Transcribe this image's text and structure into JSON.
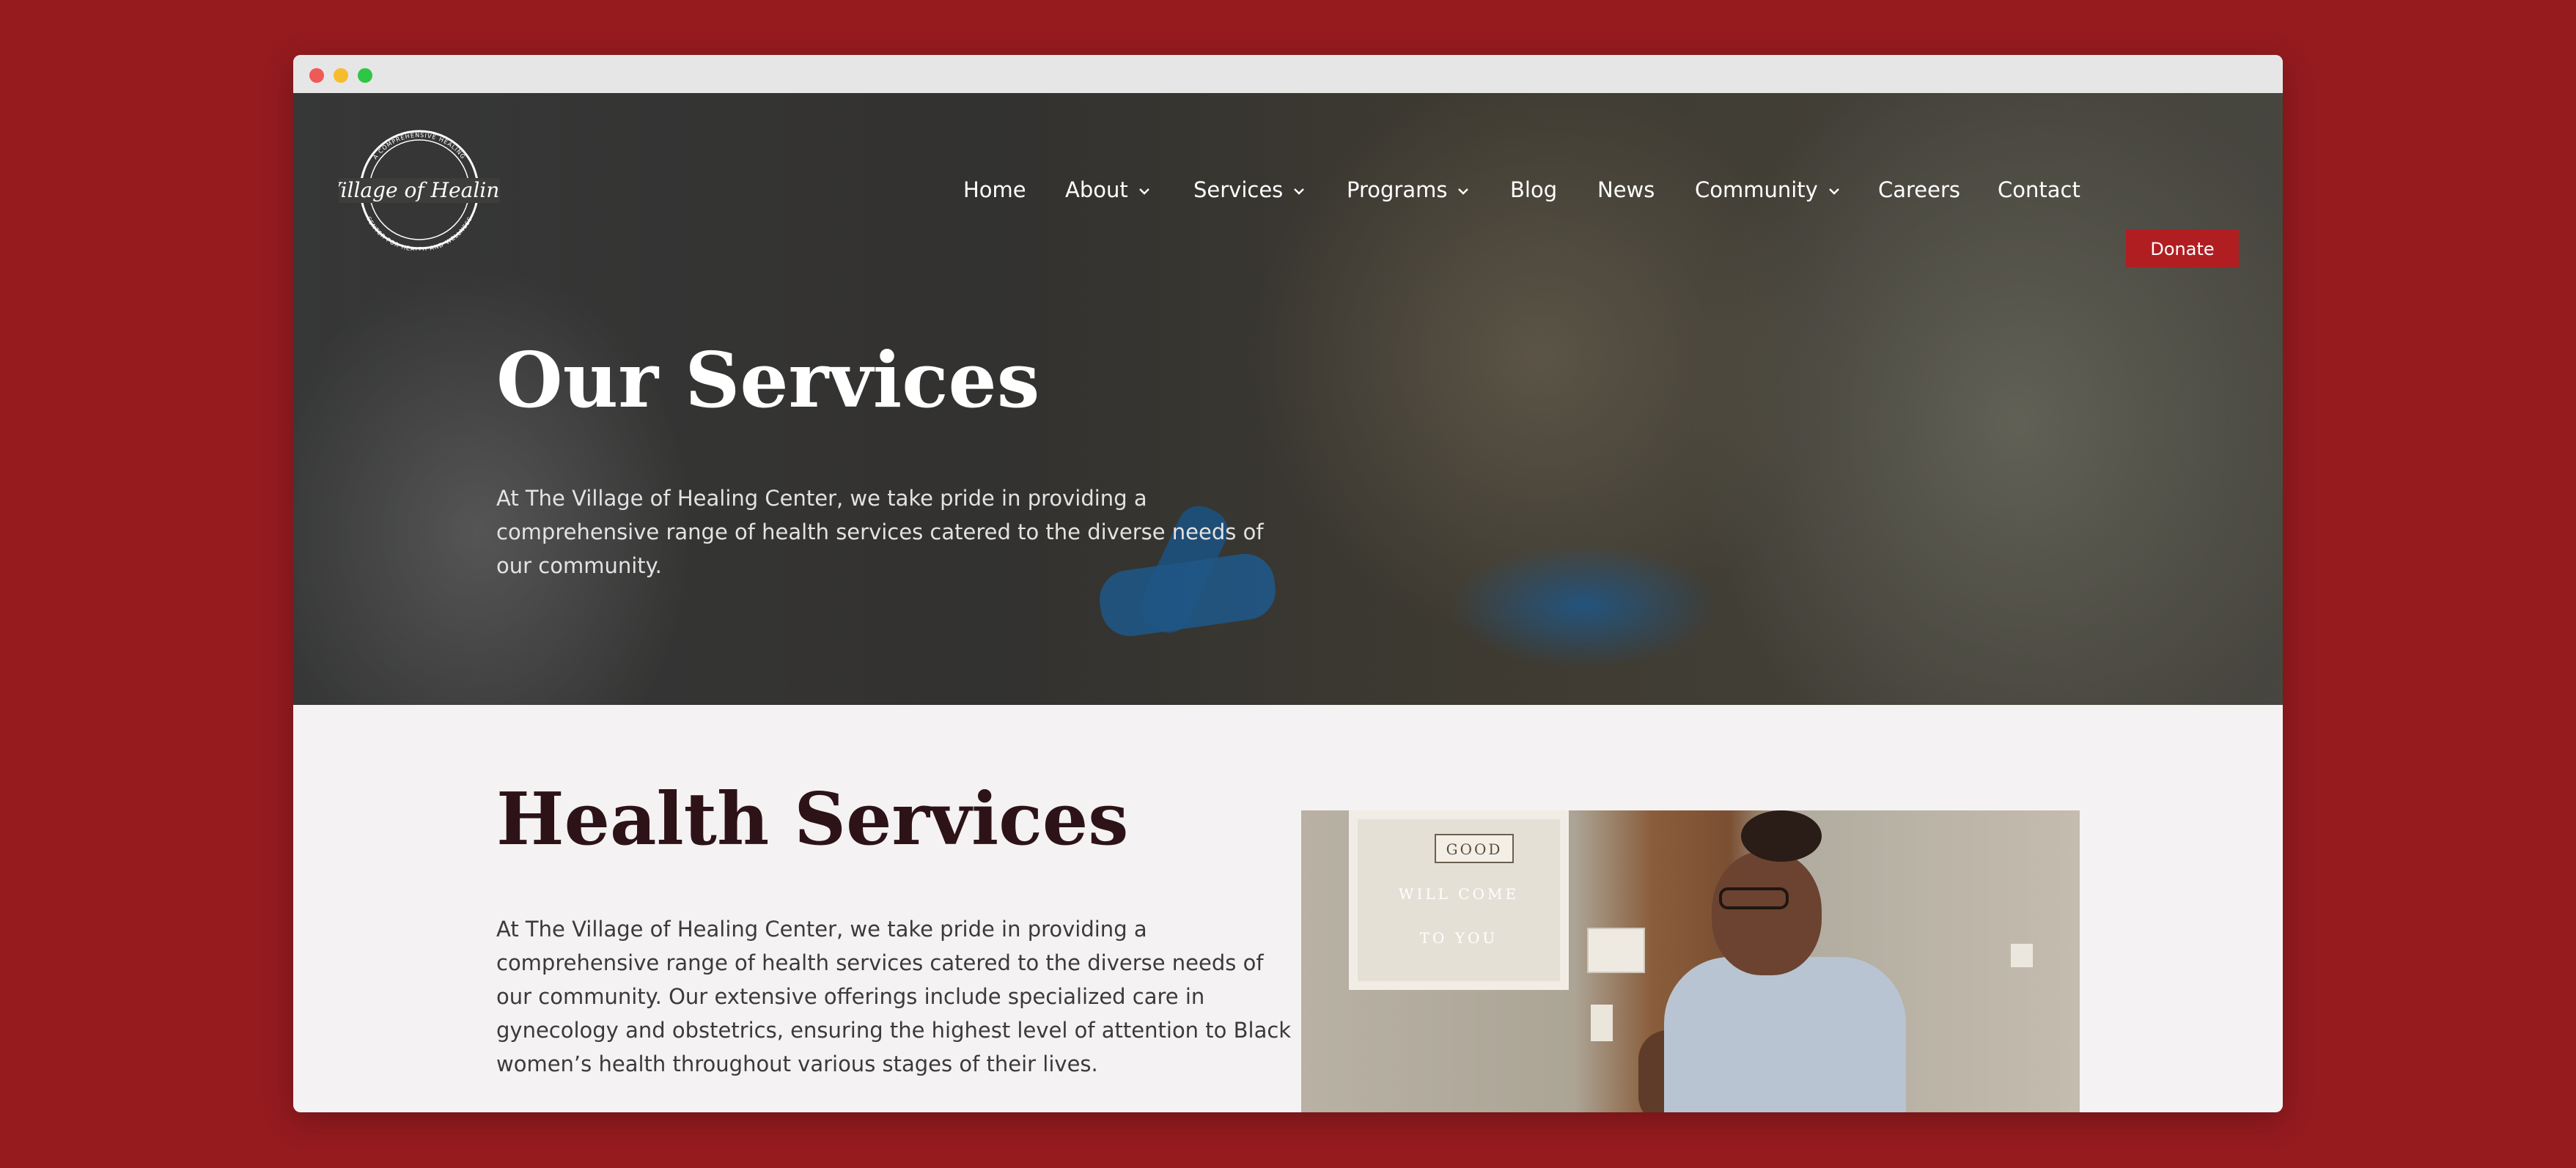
{
  "window": {
    "controls": [
      "close",
      "minimize",
      "maximize"
    ]
  },
  "logo": {
    "script_text": "Village of Healing",
    "ring_text_top": "A COMPREHENSIVE HEALING",
    "ring_text_bottom": "CENTER FOR HEALTH AND WELLNESS"
  },
  "nav": {
    "items": [
      {
        "label": "Home",
        "dropdown": false
      },
      {
        "label": "About",
        "dropdown": true
      },
      {
        "label": "Services",
        "dropdown": true
      },
      {
        "label": "Programs",
        "dropdown": true
      },
      {
        "label": "Blog",
        "dropdown": false
      },
      {
        "label": "News",
        "dropdown": false
      },
      {
        "label": "Community",
        "dropdown": true
      },
      {
        "label": "Careers",
        "dropdown": false
      },
      {
        "label": "Contact",
        "dropdown": false
      }
    ],
    "donate_label": "Donate"
  },
  "hero": {
    "title": "Our Services",
    "description": "At The Village of Healing Center, we take pride in providing a comprehensive range of health services catered to the diverse needs of our community."
  },
  "health_services": {
    "title": "Health Services",
    "description": "At The Village of Healing Center, we take pride in providing a comprehensive range of health services catered to the diverse needs of our community. Our extensive offerings include specialized care in gynecology and obstetrics, ensuring the highest level of attention to Black women’s health throughout various stages of their lives.",
    "photo": {
      "sign_tag": "GOOD",
      "sign_line1": "WILL COME",
      "sign_line2": "TO YOU"
    }
  },
  "colors": {
    "page_background": "#951b1f",
    "donate_button": "#b01e22",
    "heading_dark": "#2d1318",
    "hero_text": "#ffffff"
  }
}
